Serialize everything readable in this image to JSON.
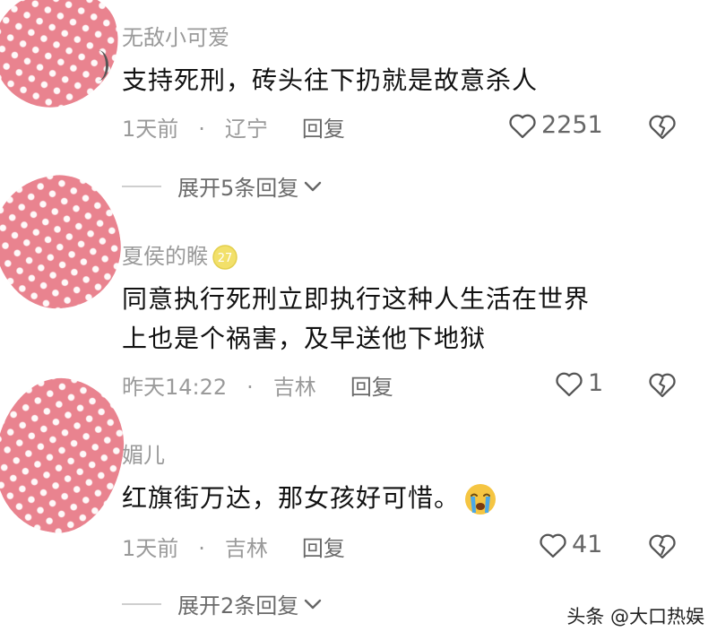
{
  "comments": [
    {
      "username": "无敌小可爱",
      "content_lines": [
        "支持死刑，砖头往下扔就是故意杀人"
      ],
      "time": "1天前",
      "separator": "·",
      "location": "辽宁",
      "reply_label": "回复",
      "likes": "2251",
      "expand_label": "展开5条回复"
    },
    {
      "username": "夏侯的睺",
      "username_badge": "level-badge-icon",
      "content_lines": [
        "同意执行死刑立即执行这种人生活在世界",
        "上也是个祸害，及早送他下地狱"
      ],
      "time": "昨天14:22",
      "separator": "·",
      "location": "吉林",
      "reply_label": "回复",
      "likes": "1"
    },
    {
      "username": "媚儿",
      "content_lines": [
        "红旗街万达，那女孩好可惜。"
      ],
      "emoji": "crying-face-emoji",
      "time": "1天前",
      "separator": "·",
      "location": "吉林",
      "reply_label": "回复",
      "likes": "41",
      "expand_label": "展开2条回复"
    }
  ],
  "watermark": "头条 @大口热娱",
  "colors": {
    "avatar": "#e9838f",
    "muted": "#9a9a9a",
    "badge": "#f2e06a",
    "emoji": "#f5c542"
  }
}
